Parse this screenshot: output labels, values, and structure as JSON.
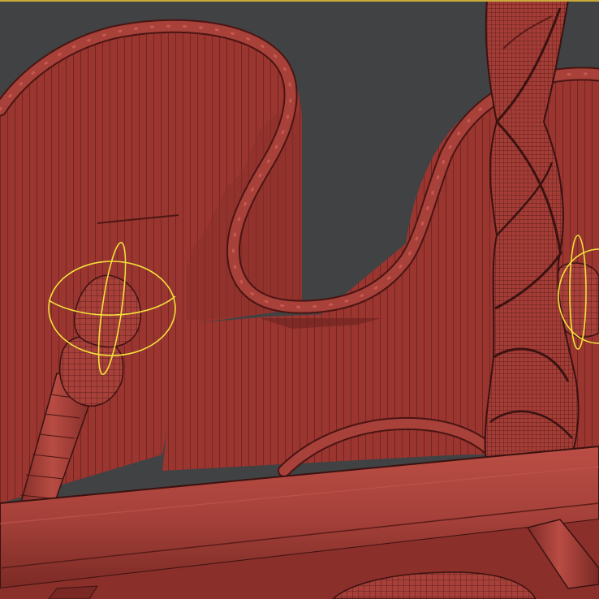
{
  "scene": {
    "background_color": "#414243",
    "mesh_fill": "#9e3a34",
    "mesh_fill_light": "#b44a42",
    "mesh_fill_dark": "#7a2824",
    "wire_color": "#3a1210",
    "gizmo_color": "#f2e23a",
    "viewport_border_color": "#c9a93a"
  }
}
